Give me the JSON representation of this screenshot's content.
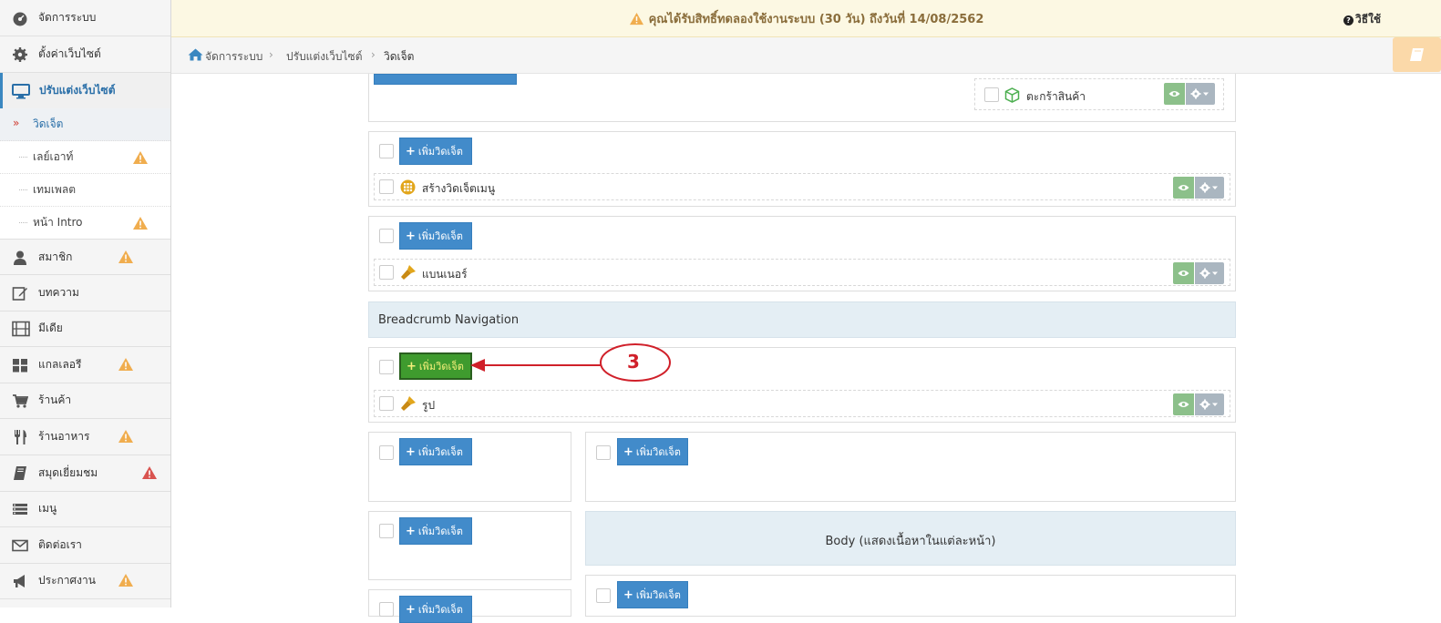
{
  "notice": {
    "text": "คุณได้รับสิทธิ์ทดลองใช้งานระบบ (30 วัน) ถึงวันที่ 14/08/2562"
  },
  "breadcrumb": {
    "home": "จัดการระบบ",
    "level2": "ปรับแต่งเว็บไซต์",
    "current": "วิดเจ็ต"
  },
  "help": {
    "label": "วิธีใช้"
  },
  "sidebar": {
    "system": "จัดการระบบ",
    "settings": "ตั้งค่าเว็บไซต์",
    "customize": "ปรับแต่งเว็บไซต์",
    "sub": {
      "widget": "วิดเจ็ต",
      "layout": "เลย์เอาท์",
      "template": "เทมเพลต",
      "intro": "หน้า Intro"
    },
    "members": "สมาชิก",
    "articles": "บทความ",
    "media": "มีเดีย",
    "gallery": "แกลเลอรี",
    "shop": "ร้านค้า",
    "restaurant": "ร้านอาหาร",
    "guestbook": "สมุดเยี่ยมชม",
    "menu": "เมนู",
    "contact": "ติดต่อเรา",
    "announce": "ประกาศงาน"
  },
  "widgets": {
    "add_label": "เพิ่มวิดเจ็ต",
    "cart": "ตะกร้าสินค้า",
    "menu_builder": "สร้างวิดเจ็ตเมนู",
    "banner": "แบนเนอร์",
    "breadcrumb_nav": "Breadcrumb Navigation",
    "picture": "รูป",
    "body_heading": "Body (แสดงเนื้อหาในแต่ละหน้า)"
  },
  "annotation": {
    "number": "3"
  },
  "colors": {
    "primary": "#428bca",
    "highlight": "#3f9b2e",
    "annotation": "#d0202a",
    "warning": "#f0ad4e",
    "danger": "#d9534f"
  }
}
